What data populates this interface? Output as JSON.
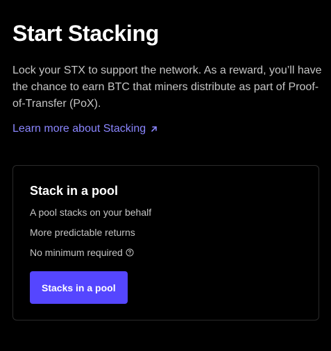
{
  "header": {
    "title": "Start Stacking",
    "intro_lines": [
      "Lock your STX to support the network. As a reward, you’ll have",
      "the chance to earn BTC that miners distribute as part of Proof-",
      "of-Transfer (PoX)."
    ],
    "learn_more_label": "Learn more about Stacking",
    "learn_more_icon": "arrow-up-right-icon"
  },
  "pool_card": {
    "title": "Stack in a pool",
    "features": [
      "A pool stacks on your behalf",
      "More predictable returns",
      "No minimum required"
    ],
    "info_icon": "info-circle-icon",
    "button_label": "Stacks in a pool"
  },
  "colors": {
    "background": "#000000",
    "accent": "#5546ff",
    "link": "#8b86ff",
    "card_border": "#2b2b2b",
    "muted_text": "#c6c6c6"
  }
}
